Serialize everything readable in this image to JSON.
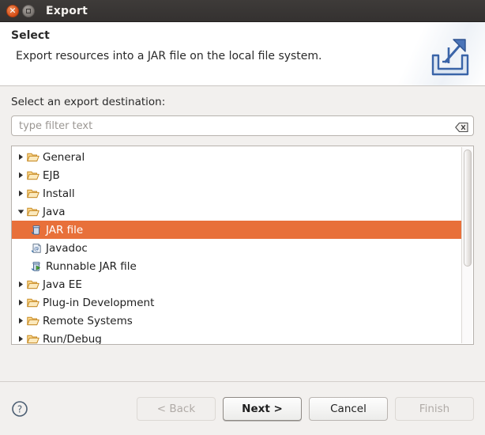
{
  "window": {
    "title": "Export",
    "controls": [
      {
        "name": "close-button",
        "icon": "close-icon",
        "glyph": "×"
      },
      {
        "name": "maximize-button",
        "icon": "maximize-icon",
        "glyph": "□"
      }
    ]
  },
  "header": {
    "title": "Select",
    "description": "Export resources into a JAR file on the local file system.",
    "icon": "export-wizard-icon"
  },
  "form": {
    "destination_label": "Select an export destination:",
    "filter": {
      "value": "",
      "placeholder": "type filter text",
      "clear_icon": "clear-backspace-icon"
    }
  },
  "tree": {
    "selected": "JAR file",
    "rows": [
      {
        "label": "General",
        "level": 0,
        "expanded": false,
        "icon": "folder-icon",
        "selected": false
      },
      {
        "label": "EJB",
        "level": 0,
        "expanded": false,
        "icon": "folder-icon",
        "selected": false
      },
      {
        "label": "Install",
        "level": 0,
        "expanded": false,
        "icon": "folder-icon",
        "selected": false
      },
      {
        "label": "Java",
        "level": 0,
        "expanded": true,
        "icon": "folder-icon",
        "selected": false
      },
      {
        "label": "JAR file",
        "level": 1,
        "expanded": null,
        "icon": "jar-file-icon",
        "selected": true
      },
      {
        "label": "Javadoc",
        "level": 1,
        "expanded": null,
        "icon": "javadoc-icon",
        "selected": false
      },
      {
        "label": "Runnable JAR file",
        "level": 1,
        "expanded": null,
        "icon": "runnable-jar-icon",
        "selected": false
      },
      {
        "label": "Java EE",
        "level": 0,
        "expanded": false,
        "icon": "folder-icon",
        "selected": false
      },
      {
        "label": "Plug-in Development",
        "level": 0,
        "expanded": false,
        "icon": "folder-icon",
        "selected": false
      },
      {
        "label": "Remote Systems",
        "level": 0,
        "expanded": false,
        "icon": "folder-icon",
        "selected": false
      },
      {
        "label": "Run/Debug",
        "level": 0,
        "expanded": false,
        "icon": "folder-icon",
        "selected": false
      }
    ]
  },
  "footer": {
    "help_icon": "help-question-icon",
    "buttons": [
      {
        "label": "< Back",
        "name": "back-button",
        "enabled": false,
        "default": false
      },
      {
        "label": "Next >",
        "name": "next-button",
        "enabled": true,
        "default": true
      },
      {
        "label": "Cancel",
        "name": "cancel-button",
        "enabled": true,
        "default": false
      },
      {
        "label": "Finish",
        "name": "finish-button",
        "enabled": false,
        "default": false
      }
    ]
  },
  "colors": {
    "selection": "#e8703a",
    "titlebar": "#3a3735",
    "dialog_bg": "#f2f0ee",
    "folder": "#f0b95c",
    "close_button": "#d44b15"
  }
}
